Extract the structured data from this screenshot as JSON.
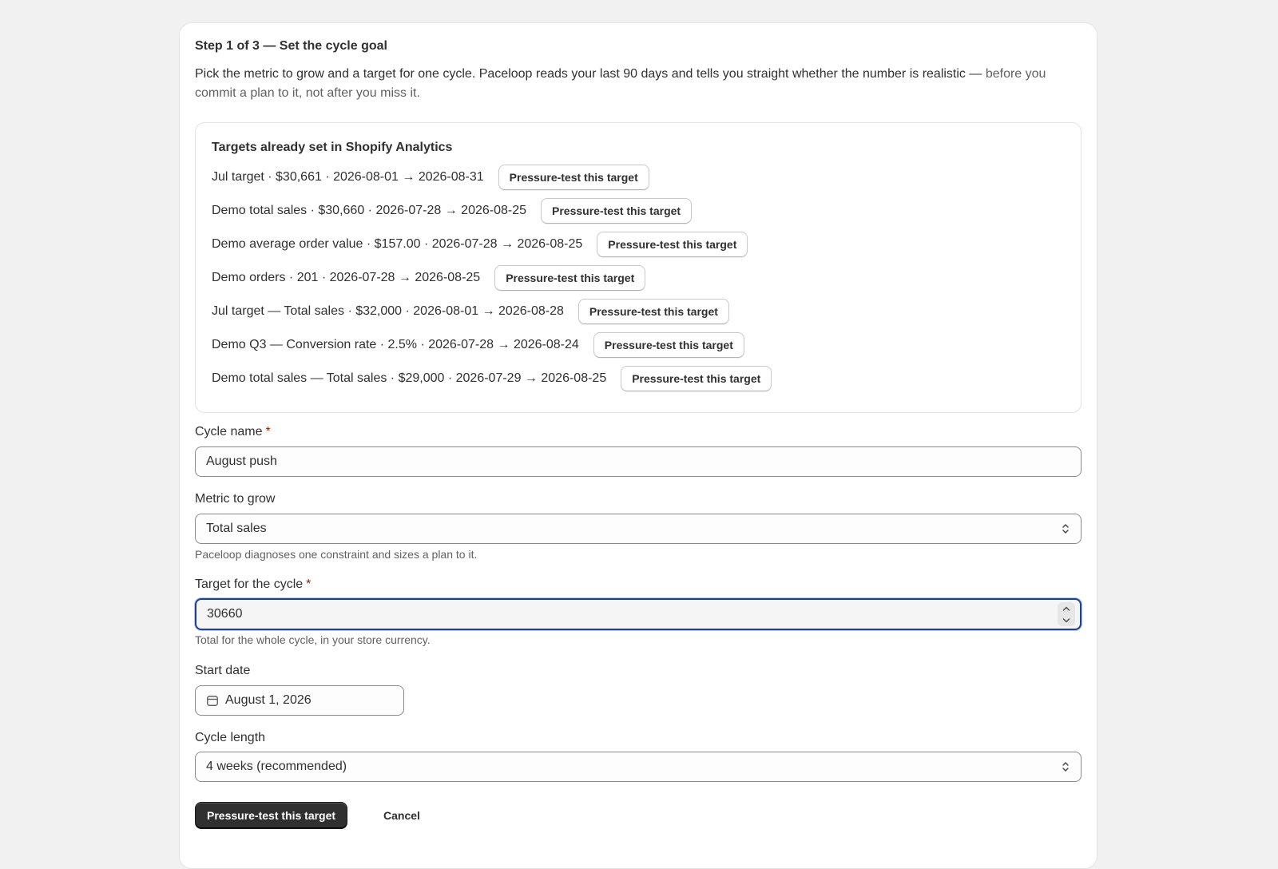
{
  "step": {
    "title": "Step 1 of 3 — Set the cycle goal",
    "intro_main": "Pick the metric to grow and a target for one cycle. Paceloop reads your last 90 days and tells you straight whether the number is realistic — ",
    "intro_muted": "before you commit a plan to it, not after you miss it."
  },
  "targets": {
    "title": "Targets already set in Shopify Analytics",
    "button_label": "Pressure-test this target",
    "items": [
      {
        "text": "Jul target · $30,661 · 2026-08-01 → 2026-08-31"
      },
      {
        "text": "Demo total sales · $30,660 · 2026-07-28 → 2026-08-25"
      },
      {
        "text": "Demo average order value · $157.00 · 2026-07-28 → 2026-08-25"
      },
      {
        "text": "Demo orders · 201 · 2026-07-28 → 2026-08-25"
      },
      {
        "text": "Jul target — Total sales · $32,000 · 2026-08-01 → 2026-08-28"
      },
      {
        "text": "Demo Q3 — Conversion rate · 2.5% · 2026-07-28 → 2026-08-24"
      },
      {
        "text": "Demo total sales — Total sales · $29,000 · 2026-07-29 → 2026-08-25"
      }
    ]
  },
  "form": {
    "cycle_name": {
      "label": "Cycle name",
      "required_mark": "*",
      "value": "August push"
    },
    "metric": {
      "label": "Metric to grow",
      "value": "Total sales",
      "help": "Paceloop diagnoses one constraint and sizes a plan to it."
    },
    "target": {
      "label": "Target for the cycle",
      "required_mark": "*",
      "value": "30660",
      "help": "Total for the whole cycle, in your store currency."
    },
    "start_date": {
      "label": "Start date",
      "value": "August 1, 2026"
    },
    "cycle_length": {
      "label": "Cycle length",
      "value": "4 weeks (recommended)"
    }
  },
  "actions": {
    "primary_label": "Pressure-test this target",
    "cancel_label": "Cancel"
  },
  "colors": {
    "page_bg": "#f1f1f1",
    "primary_button": "#303030",
    "required_mark": "#8e1f0b",
    "focus_ring": "#1f3f8f"
  },
  "icons": {
    "select_chevron": "chevron-up-down-icon",
    "date": "calendar-icon",
    "stepper": "number-stepper-icon"
  }
}
